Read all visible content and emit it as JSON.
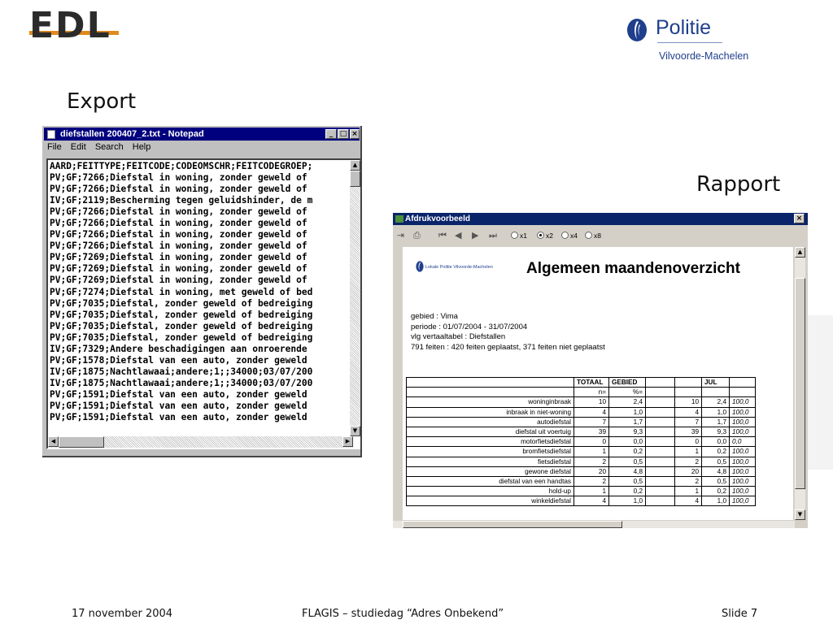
{
  "header": {
    "edl_logo": "EDL",
    "politie_name": "Politie",
    "politie_region": "Vilvoorde-Machelen"
  },
  "labels": {
    "export": "Export",
    "rapport": "Rapport"
  },
  "notepad": {
    "title": "diefstallen 200407_2.txt - Notepad",
    "menu": [
      "File",
      "Edit",
      "Search",
      "Help"
    ],
    "lines": [
      "AARD;FEITTYPE;FEITCODE;CODEOMSCHR;FEITCODEGROEP;",
      "PV;GF;7266;Diefstal in woning, zonder geweld of",
      "PV;GF;7266;Diefstal in woning, zonder geweld of",
      "IV;GF;2119;Bescherming tegen geluidshinder, de m",
      "PV;GF;7266;Diefstal in woning, zonder geweld of",
      "PV;GF;7266;Diefstal in woning, zonder geweld of",
      "PV;GF;7266;Diefstal in woning, zonder geweld of",
      "PV;GF;7266;Diefstal in woning, zonder geweld of",
      "PV;GF;7269;Diefstal in woning, zonder geweld of",
      "PV;GF;7269;Diefstal in woning, zonder geweld of",
      "PV;GF;7269;Diefstal in woning, zonder geweld of",
      "PV;GF;7274;Diefstal in woning, met geweld of bed",
      "PV;GF;7035;Diefstal, zonder geweld of bedreiging",
      "PV;GF;7035;Diefstal, zonder geweld of bedreiging",
      "PV;GF;7035;Diefstal, zonder geweld of bedreiging",
      "PV;GF;7035;Diefstal, zonder geweld of bedreiging",
      "IV;GF;7329;Andere beschadigingen aan onroerende",
      "PV;GF;1578;Diefstal van een auto, zonder geweld",
      "IV;GF;1875;Nachtlawaai;andere;1;;34000;03/07/200",
      "IV;GF;1875;Nachtlawaai;andere;1;;34000;03/07/200",
      "PV;GF;1591;Diefstal van een auto, zonder geweld",
      "PV;GF;1591;Diefstal van een auto, zonder geweld",
      "PV;GF;1591;Diefstal van een auto, zonder geweld"
    ]
  },
  "preview": {
    "title": "Afdrukvoorbeeld",
    "zoom_options": [
      "x1",
      "x2",
      "x4",
      "x8"
    ],
    "zoom_selected": "x2",
    "report": {
      "logo_text": "Lokale Politie Vilvoorde-Machelen",
      "title": "Algemeen maandenoverzicht",
      "gebied": "gebied : Vima",
      "periode": "periode : 01/07/2004 - 31/07/2004",
      "vertaaltabel": "vlg vertaaltabel : Diefstallen",
      "feiten": "791 feiten : 420 feiten geplaatst, 371 feiten niet geplaatst"
    },
    "table": {
      "header": [
        "",
        "TOTAAL",
        "GEBIED",
        "",
        "",
        "JUL",
        ""
      ],
      "subheader": [
        "",
        "n=",
        "%=",
        "",
        "",
        "",
        ""
      ],
      "rows": [
        [
          "woninginbraak",
          "10",
          "2,4",
          "",
          "10",
          "2,4",
          "100,0"
        ],
        [
          "inbraak in niet-woning",
          "4",
          "1,0",
          "",
          "4",
          "1,0",
          "100,0"
        ],
        [
          "autodiefstal",
          "7",
          "1,7",
          "",
          "7",
          "1,7",
          "100,0"
        ],
        [
          "diefstal uit voertuig",
          "39",
          "9,3",
          "",
          "39",
          "9,3",
          "100,0"
        ],
        [
          "motorfietsdiefstal",
          "0",
          "0,0",
          "",
          "0",
          "0,0",
          "0,0"
        ],
        [
          "bromfietsdiefstal",
          "1",
          "0,2",
          "",
          "1",
          "0,2",
          "100,0"
        ],
        [
          "fietsdiefstal",
          "2",
          "0,5",
          "",
          "2",
          "0,5",
          "100,0"
        ],
        [
          "gewone diefstal",
          "20",
          "4,8",
          "",
          "20",
          "4,8",
          "100,0"
        ],
        [
          "diefstal van een handtas",
          "2",
          "0,5",
          "",
          "2",
          "0,5",
          "100,0"
        ],
        [
          "hold-up",
          "1",
          "0,2",
          "",
          "1",
          "0,2",
          "100,0"
        ],
        [
          "winkeldiefstal",
          "4",
          "1,0",
          "",
          "4",
          "1,0",
          "100,0"
        ]
      ]
    }
  },
  "footer": {
    "date": "17 november 2004",
    "event": "FLAGIS – studiedag “Adres Onbekend”",
    "slide": "Slide 7"
  },
  "colors": {
    "edl_accent": "#e08a1e",
    "politie_blue": "#1f3f8c",
    "titlebar": "#00007f"
  }
}
